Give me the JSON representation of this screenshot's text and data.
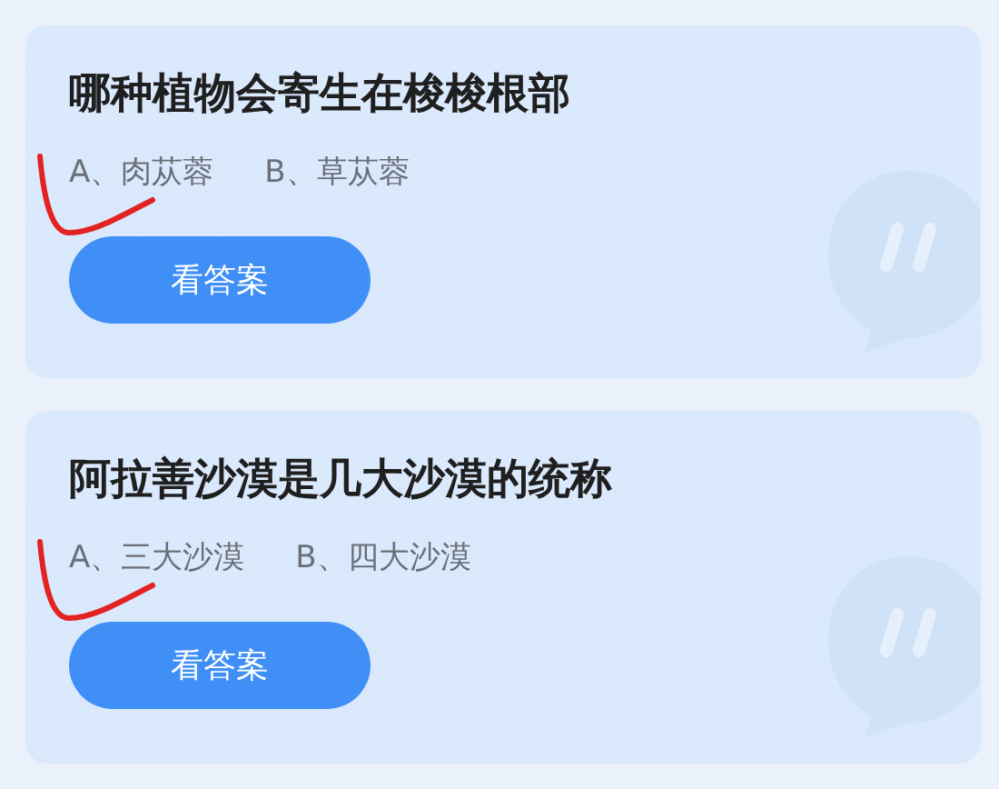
{
  "cards": [
    {
      "question": "哪种植物会寄生在梭梭根部",
      "options": [
        "A、肉苁蓉",
        "B、草苁蓉"
      ],
      "button": "看答案",
      "marked": true
    },
    {
      "question": "阿拉善沙漠是几大沙漠的统称",
      "options": [
        "A、三大沙漠",
        "B、四大沙漠"
      ],
      "button": "看答案",
      "marked": true
    }
  ]
}
